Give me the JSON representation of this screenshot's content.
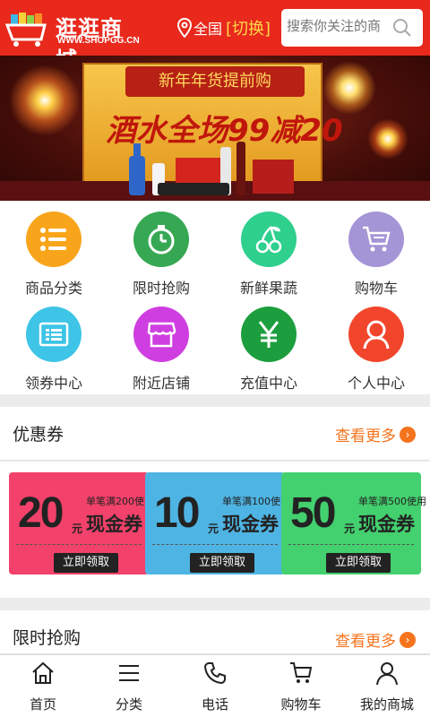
{
  "header": {
    "logo_name": "逛逛商城",
    "logo_url": "WWW.SHOPGG.CN",
    "location": "全国",
    "switch_label": "[切换]",
    "search_placeholder": "搜索你关注的商",
    "bg_color": "#e8291c"
  },
  "banner": {
    "ribbon_text": "新年年货提前购",
    "promo_text": "酒水全场99减20"
  },
  "categories": [
    {
      "label": "商品分类",
      "icon": "list-icon",
      "color": "#f9a51c"
    },
    {
      "label": "限时抢购",
      "icon": "timer-icon",
      "color": "#36a853"
    },
    {
      "label": "新鲜果蔬",
      "icon": "cherry-icon",
      "color": "#2fcf8e"
    },
    {
      "label": "购物车",
      "icon": "cart-icon",
      "color": "#a495d6"
    },
    {
      "label": "领券中心",
      "icon": "coupon-icon",
      "color": "#3ec4e6"
    },
    {
      "label": "附近店铺",
      "icon": "store-icon",
      "color": "#cf3ee0"
    },
    {
      "label": "充值中心",
      "icon": "yen-icon",
      "color": "#1d9e3e"
    },
    {
      "label": "个人中心",
      "icon": "person-icon",
      "color": "#f1462c"
    }
  ],
  "coupon_section": {
    "title": "优惠券",
    "more": "查看更多",
    "coupons": [
      {
        "amount": "20",
        "unit": "元",
        "condition": "单笔满200使",
        "kind": "现金券",
        "button": "立即领取",
        "color": "#f2416a"
      },
      {
        "amount": "10",
        "unit": "元",
        "condition": "单笔满100使",
        "kind": "现金券",
        "button": "立即领取",
        "color": "#4eb4e3"
      },
      {
        "amount": "50",
        "unit": "元",
        "condition": "单笔满500使用",
        "kind": "现金券",
        "button": "立即领取",
        "color": "#43d06e"
      }
    ]
  },
  "flash_section": {
    "title": "限时抢购",
    "more": "查看更多"
  },
  "bottom_nav": [
    {
      "label": "首页",
      "icon": "home-icon"
    },
    {
      "label": "分类",
      "icon": "menu-icon"
    },
    {
      "label": "电话",
      "icon": "phone-icon"
    },
    {
      "label": "购物车",
      "icon": "cart-icon"
    },
    {
      "label": "我的商城",
      "icon": "user-icon"
    }
  ]
}
